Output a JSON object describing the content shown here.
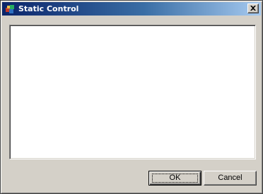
{
  "window": {
    "title": "Static Control",
    "icon": "application-icon"
  },
  "titlebar": {
    "close_icon": "close-icon"
  },
  "buttons": {
    "ok_label": "OK",
    "cancel_label": "Cancel"
  },
  "colors": {
    "titlebar_start": "#0a246a",
    "titlebar_end": "#a6caf0",
    "face": "#d4d0c8",
    "content_bg": "#ffffff"
  }
}
